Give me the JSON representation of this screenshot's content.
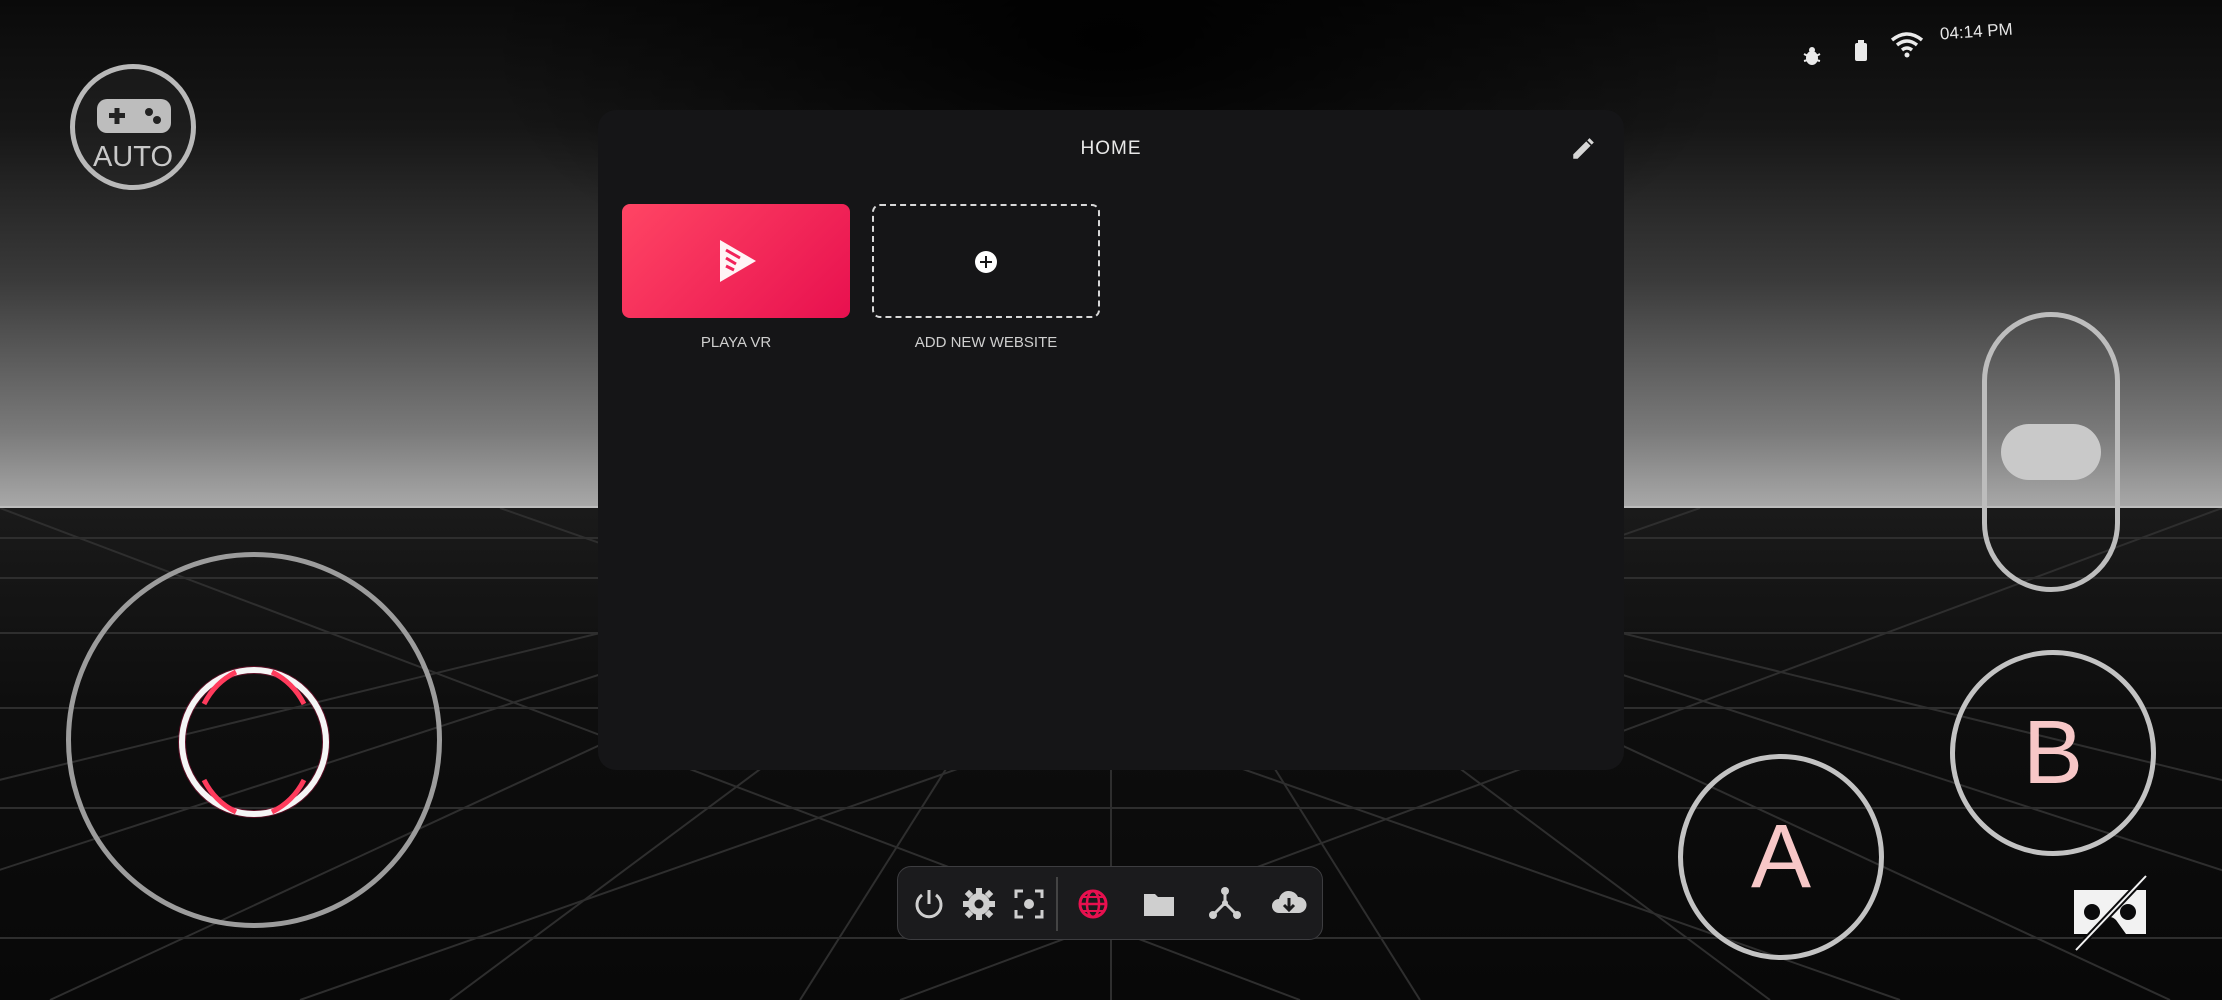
{
  "status_bar": {
    "time": "04:14 PM",
    "icons": [
      "bug-icon",
      "battery-icon",
      "wifi-icon"
    ]
  },
  "controller_mode": {
    "label": "AUTO",
    "icon": "gamepad-icon"
  },
  "browser_panel": {
    "title": "HOME",
    "edit_icon": "pencil-icon",
    "tiles": [
      {
        "label": "PLAYA VR",
        "icon": "play-logo-icon",
        "color": "#f2215a"
      },
      {
        "label": "ADD NEW WEBSITE",
        "icon": "add-circle-icon"
      }
    ]
  },
  "dock": {
    "items": [
      "power-icon",
      "settings-icon",
      "recenter-icon",
      "globe-icon",
      "folder-icon",
      "network-icon",
      "cloud-download-icon"
    ],
    "active": "globe-icon",
    "accent": "#e8104f"
  },
  "buttons": {
    "a_label": "A",
    "b_label": "B"
  },
  "vr_toggle_icon": "vr-headset-off-icon"
}
